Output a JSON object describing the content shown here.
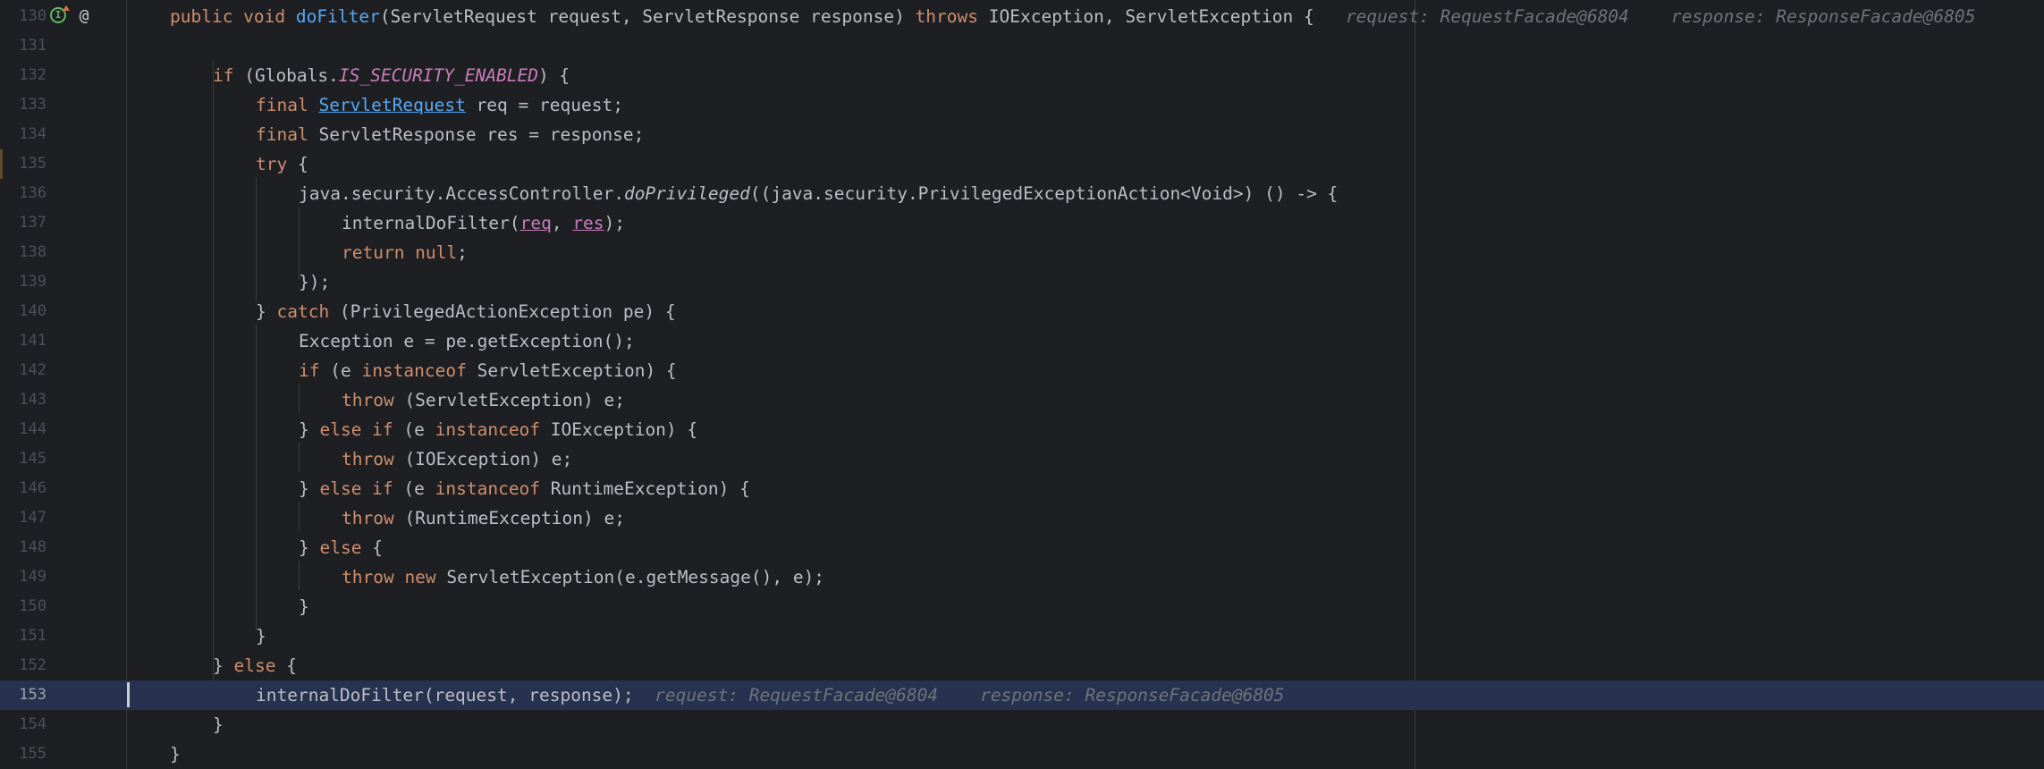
{
  "gutter": {
    "line_numbers": [
      "130",
      "131",
      "132",
      "133",
      "134",
      "135",
      "136",
      "137",
      "138",
      "139",
      "140",
      "141",
      "142",
      "143",
      "144",
      "145",
      "146",
      "147",
      "148",
      "149",
      "150",
      "151",
      "152",
      "153",
      "154",
      "155"
    ],
    "current_line": "153",
    "icons": [
      "override-up-icon",
      "annotation-at-icon"
    ]
  },
  "code": {
    "l130": {
      "kw1": "public void ",
      "fn": "doFilter",
      "a": "(ServletRequest request, ServletResponse response) ",
      "kw2": "throws",
      "b": " IOException, ServletException {",
      "hint1": "request: RequestFacade@6804",
      "hint2": "response: ResponseFacade@6805"
    },
    "l132": {
      "kw": "if",
      "a": " (Globals.",
      "const": "IS_SECURITY_ENABLED",
      "b": ") {"
    },
    "l133": {
      "kw": "final ",
      "type": "ServletRequest",
      "a": " req = request;"
    },
    "l134": {
      "kw": "final ",
      "a": "ServletResponse res = response;"
    },
    "l135": {
      "kw": "try",
      "a": " {"
    },
    "l136": {
      "a": "java.security.AccessController.",
      "it": "doPrivileged",
      "b": "((java.security.PrivilegedExceptionAction<Void>) () -> {"
    },
    "l137": {
      "a": "internalDoFilter(",
      "p1": "req",
      "b": ", ",
      "p2": "res",
      "c": ");"
    },
    "l138": {
      "kw": "return null",
      "a": ";"
    },
    "l139": {
      "a": "});"
    },
    "l140": {
      "a": "} ",
      "kw": "catch",
      "b": " (PrivilegedActionException pe) {"
    },
    "l141": {
      "a": "Exception e = pe.getException();"
    },
    "l142": {
      "kw": "if",
      "a": " (e ",
      "kw2": "instanceof",
      "b": " ServletException) {"
    },
    "l143": {
      "kw": "throw",
      "a": " (ServletException) e;"
    },
    "l144": {
      "a": "} ",
      "kw": "else if",
      "b": " (e ",
      "kw2": "instanceof",
      "c": " IOException) {"
    },
    "l145": {
      "kw": "throw",
      "a": " (IOException) e;"
    },
    "l146": {
      "a": "} ",
      "kw": "else if",
      "b": " (e ",
      "kw2": "instanceof",
      "c": " RuntimeException) {"
    },
    "l147": {
      "kw": "throw",
      "a": " (RuntimeException) e;"
    },
    "l148": {
      "a": "} ",
      "kw": "else",
      "b": " {"
    },
    "l149": {
      "kw": "throw new",
      "a": " ServletException(e.getMessage(), e);"
    },
    "l150": {
      "a": "}"
    },
    "l151": {
      "a": "}"
    },
    "l152": {
      "a": "} ",
      "kw": "else",
      "b": " {"
    },
    "l153": {
      "a": "internalDoFilter(request, response);",
      "hint1": "request: RequestFacade@6804",
      "hint2": "response: ResponseFacade@6805"
    },
    "l154": {
      "a": "}"
    },
    "l155": {
      "a": "}"
    }
  },
  "colors": {
    "background": "#1e1f22",
    "keyword": "#cf8e6d",
    "function": "#56a8f5",
    "constant": "#c77dbb",
    "text": "#bcbec4",
    "hint": "#6f737a",
    "current_line": "#26324f"
  }
}
